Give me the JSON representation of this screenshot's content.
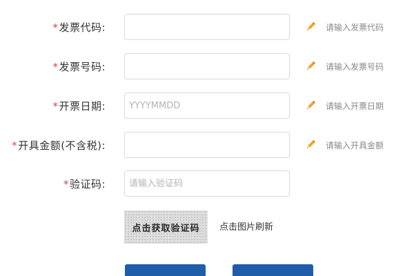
{
  "form": {
    "rows": [
      {
        "required": "*",
        "label": "发票代码:",
        "value": "",
        "placeholder": "",
        "hint": "请输入发票代码"
      },
      {
        "required": "*",
        "label": "发票号码:",
        "value": "",
        "placeholder": "",
        "hint": "请输入发票号码"
      },
      {
        "required": "*",
        "label": "开票日期:",
        "value": "",
        "placeholder": "YYYYMMDD",
        "hint": "请输入开票日期"
      },
      {
        "required": "*",
        "label": "开具金额(不含税):",
        "value": "",
        "placeholder": "",
        "hint": "请输入开具金额"
      },
      {
        "required": "*",
        "label": "验证码:",
        "value": "",
        "placeholder": "请输入验证码",
        "hint": ""
      }
    ],
    "captcha": {
      "image_text": "点击获取验证码",
      "refresh_label": "点击图片刷新"
    },
    "buttons": {
      "primary_label": "",
      "secondary_label": ""
    }
  },
  "icons": {
    "hint_icon": "pencil-icon"
  },
  "colors": {
    "required_mark": "#e0463e",
    "button_blue": "#1f5da8",
    "pencil_body": "#f0a531",
    "hint_text": "#888888"
  }
}
